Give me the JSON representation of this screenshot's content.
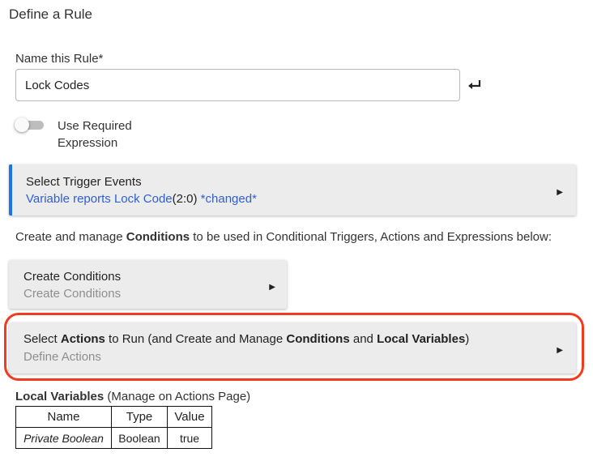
{
  "page_title": "Define a Rule",
  "name_rule": {
    "label": "Name this Rule*",
    "value": "Lock Codes",
    "enter_icon": "enter-return-icon"
  },
  "required_expression": {
    "label": "Use Required Expression",
    "enabled": false
  },
  "trigger_panel": {
    "title": "Select Trigger Events",
    "detail_link": "Variable reports Lock Code",
    "detail_value": "(2:0)",
    "detail_flag": "*changed*",
    "accent_color": "#1a73e8",
    "arrow_icon": "caret-right-icon"
  },
  "conditions_description": {
    "before": "Create and manage ",
    "bold": "Conditions",
    "after": " to be used in Conditional Triggers, Actions and Expressions below:"
  },
  "conditions_panel": {
    "title": "Create Conditions",
    "subtitle": "Create Conditions",
    "arrow_icon": "caret-right-icon"
  },
  "actions_panel": {
    "title_part1": "Select ",
    "title_bold1": "Actions",
    "title_part2": " to Run (and Create and Manage ",
    "title_bold2": "Conditions",
    "title_part3": " and ",
    "title_bold3": "Local Variables",
    "title_part4": ")",
    "subtitle": "Define Actions",
    "highlight_color": "#f23a1e",
    "arrow_icon": "caret-right-icon"
  },
  "local_variables": {
    "heading": "Local Variables",
    "note": " (Manage on Actions Page)",
    "columns": [
      "Name",
      "Type",
      "Value"
    ],
    "rows": [
      {
        "name": "Private Boolean",
        "type": "Boolean",
        "value": "true"
      }
    ]
  }
}
